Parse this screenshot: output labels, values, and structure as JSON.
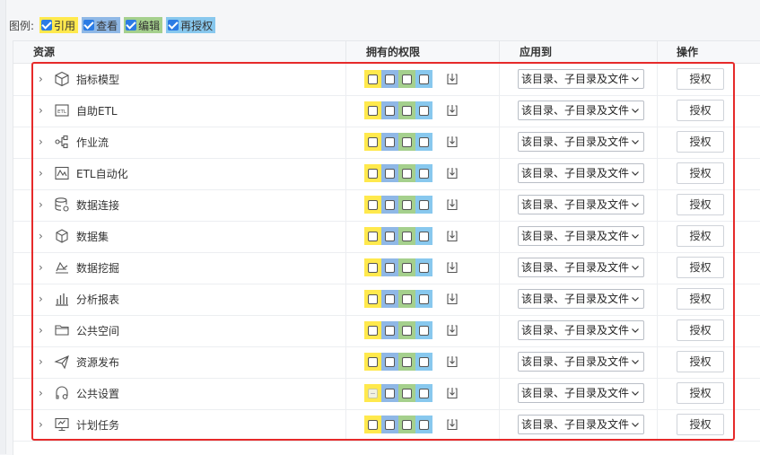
{
  "legend": {
    "label": "图例:",
    "items": [
      {
        "text": "引用",
        "color": "#ffe94d"
      },
      {
        "text": "查看",
        "color": "#8fb8e6"
      },
      {
        "text": "编辑",
        "color": "#a5d08d"
      },
      {
        "text": "再授权",
        "color": "#88c8ee"
      }
    ]
  },
  "table": {
    "headers": {
      "resource": "资源",
      "permissions": "拥有的权限",
      "apply_to": "应用到",
      "action": "操作"
    },
    "rows": [
      {
        "name": "指标模型",
        "icon": "cube-icon",
        "apply": "该目录、子目录及文件",
        "button": "授权",
        "cite_disabled": false
      },
      {
        "name": "自助ETL",
        "icon": "etl-icon",
        "apply": "该目录、子目录及文件",
        "button": "授权",
        "cite_disabled": false
      },
      {
        "name": "作业流",
        "icon": "workflow-icon",
        "apply": "该目录、子目录及文件",
        "button": "授权",
        "cite_disabled": false
      },
      {
        "name": "ETL自动化",
        "icon": "etl-automation-icon",
        "apply": "该目录、子目录及文件",
        "button": "授权",
        "cite_disabled": false
      },
      {
        "name": "数据连接",
        "icon": "database-icon",
        "apply": "该目录、子目录及文件",
        "button": "授权",
        "cite_disabled": false
      },
      {
        "name": "数据集",
        "icon": "dataset-icon",
        "apply": "该目录、子目录及文件",
        "button": "授权",
        "cite_disabled": false
      },
      {
        "name": "数据挖掘",
        "icon": "data-mining-icon",
        "apply": "该目录、子目录及文件",
        "button": "授权",
        "cite_disabled": false
      },
      {
        "name": "分析报表",
        "icon": "bar-report-icon",
        "apply": "该目录、子目录及文件",
        "button": "授权",
        "cite_disabled": false
      },
      {
        "name": "公共空间",
        "icon": "folder-icon",
        "apply": "该目录、子目录及文件",
        "button": "授权",
        "cite_disabled": false
      },
      {
        "name": "资源发布",
        "icon": "publish-icon",
        "apply": "该目录、子目录及文件",
        "button": "授权",
        "cite_disabled": false
      },
      {
        "name": "公共设置",
        "icon": "public-settings-icon",
        "apply": "该目录、子目录及文件",
        "button": "授权",
        "cite_disabled": true
      },
      {
        "name": "计划任务",
        "icon": "scheduled-task-icon",
        "apply": "该目录、子目录及文件",
        "button": "授权",
        "cite_disabled": false
      }
    ]
  },
  "colors": {
    "highlight": "#e62a2a",
    "checkbox_checked": "#2b7be4"
  }
}
